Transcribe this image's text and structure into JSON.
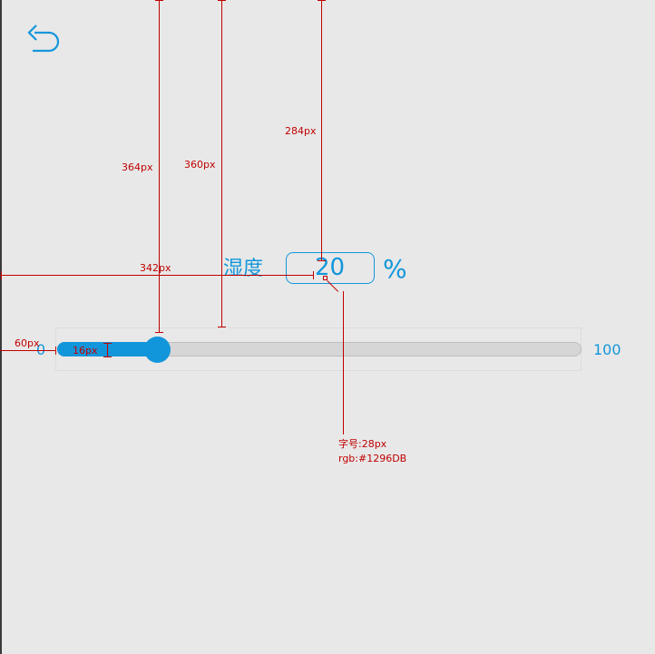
{
  "header": {
    "back_icon": "back-arrow-icon"
  },
  "humidity": {
    "label": "湿度",
    "value": "20",
    "unit": "%"
  },
  "slider": {
    "min": "0",
    "max": "100",
    "value": 20
  },
  "annotations": {
    "v1": "364px",
    "v2": "360px",
    "v3": "284px",
    "h1": "342px",
    "h2": "60px",
    "h3": "16px",
    "font_note": "字号:28px",
    "color_note": "rgb:#1296DB"
  },
  "colors": {
    "accent": "#1296DB",
    "annotation": "#C00000",
    "background": "#E8E8E8"
  }
}
